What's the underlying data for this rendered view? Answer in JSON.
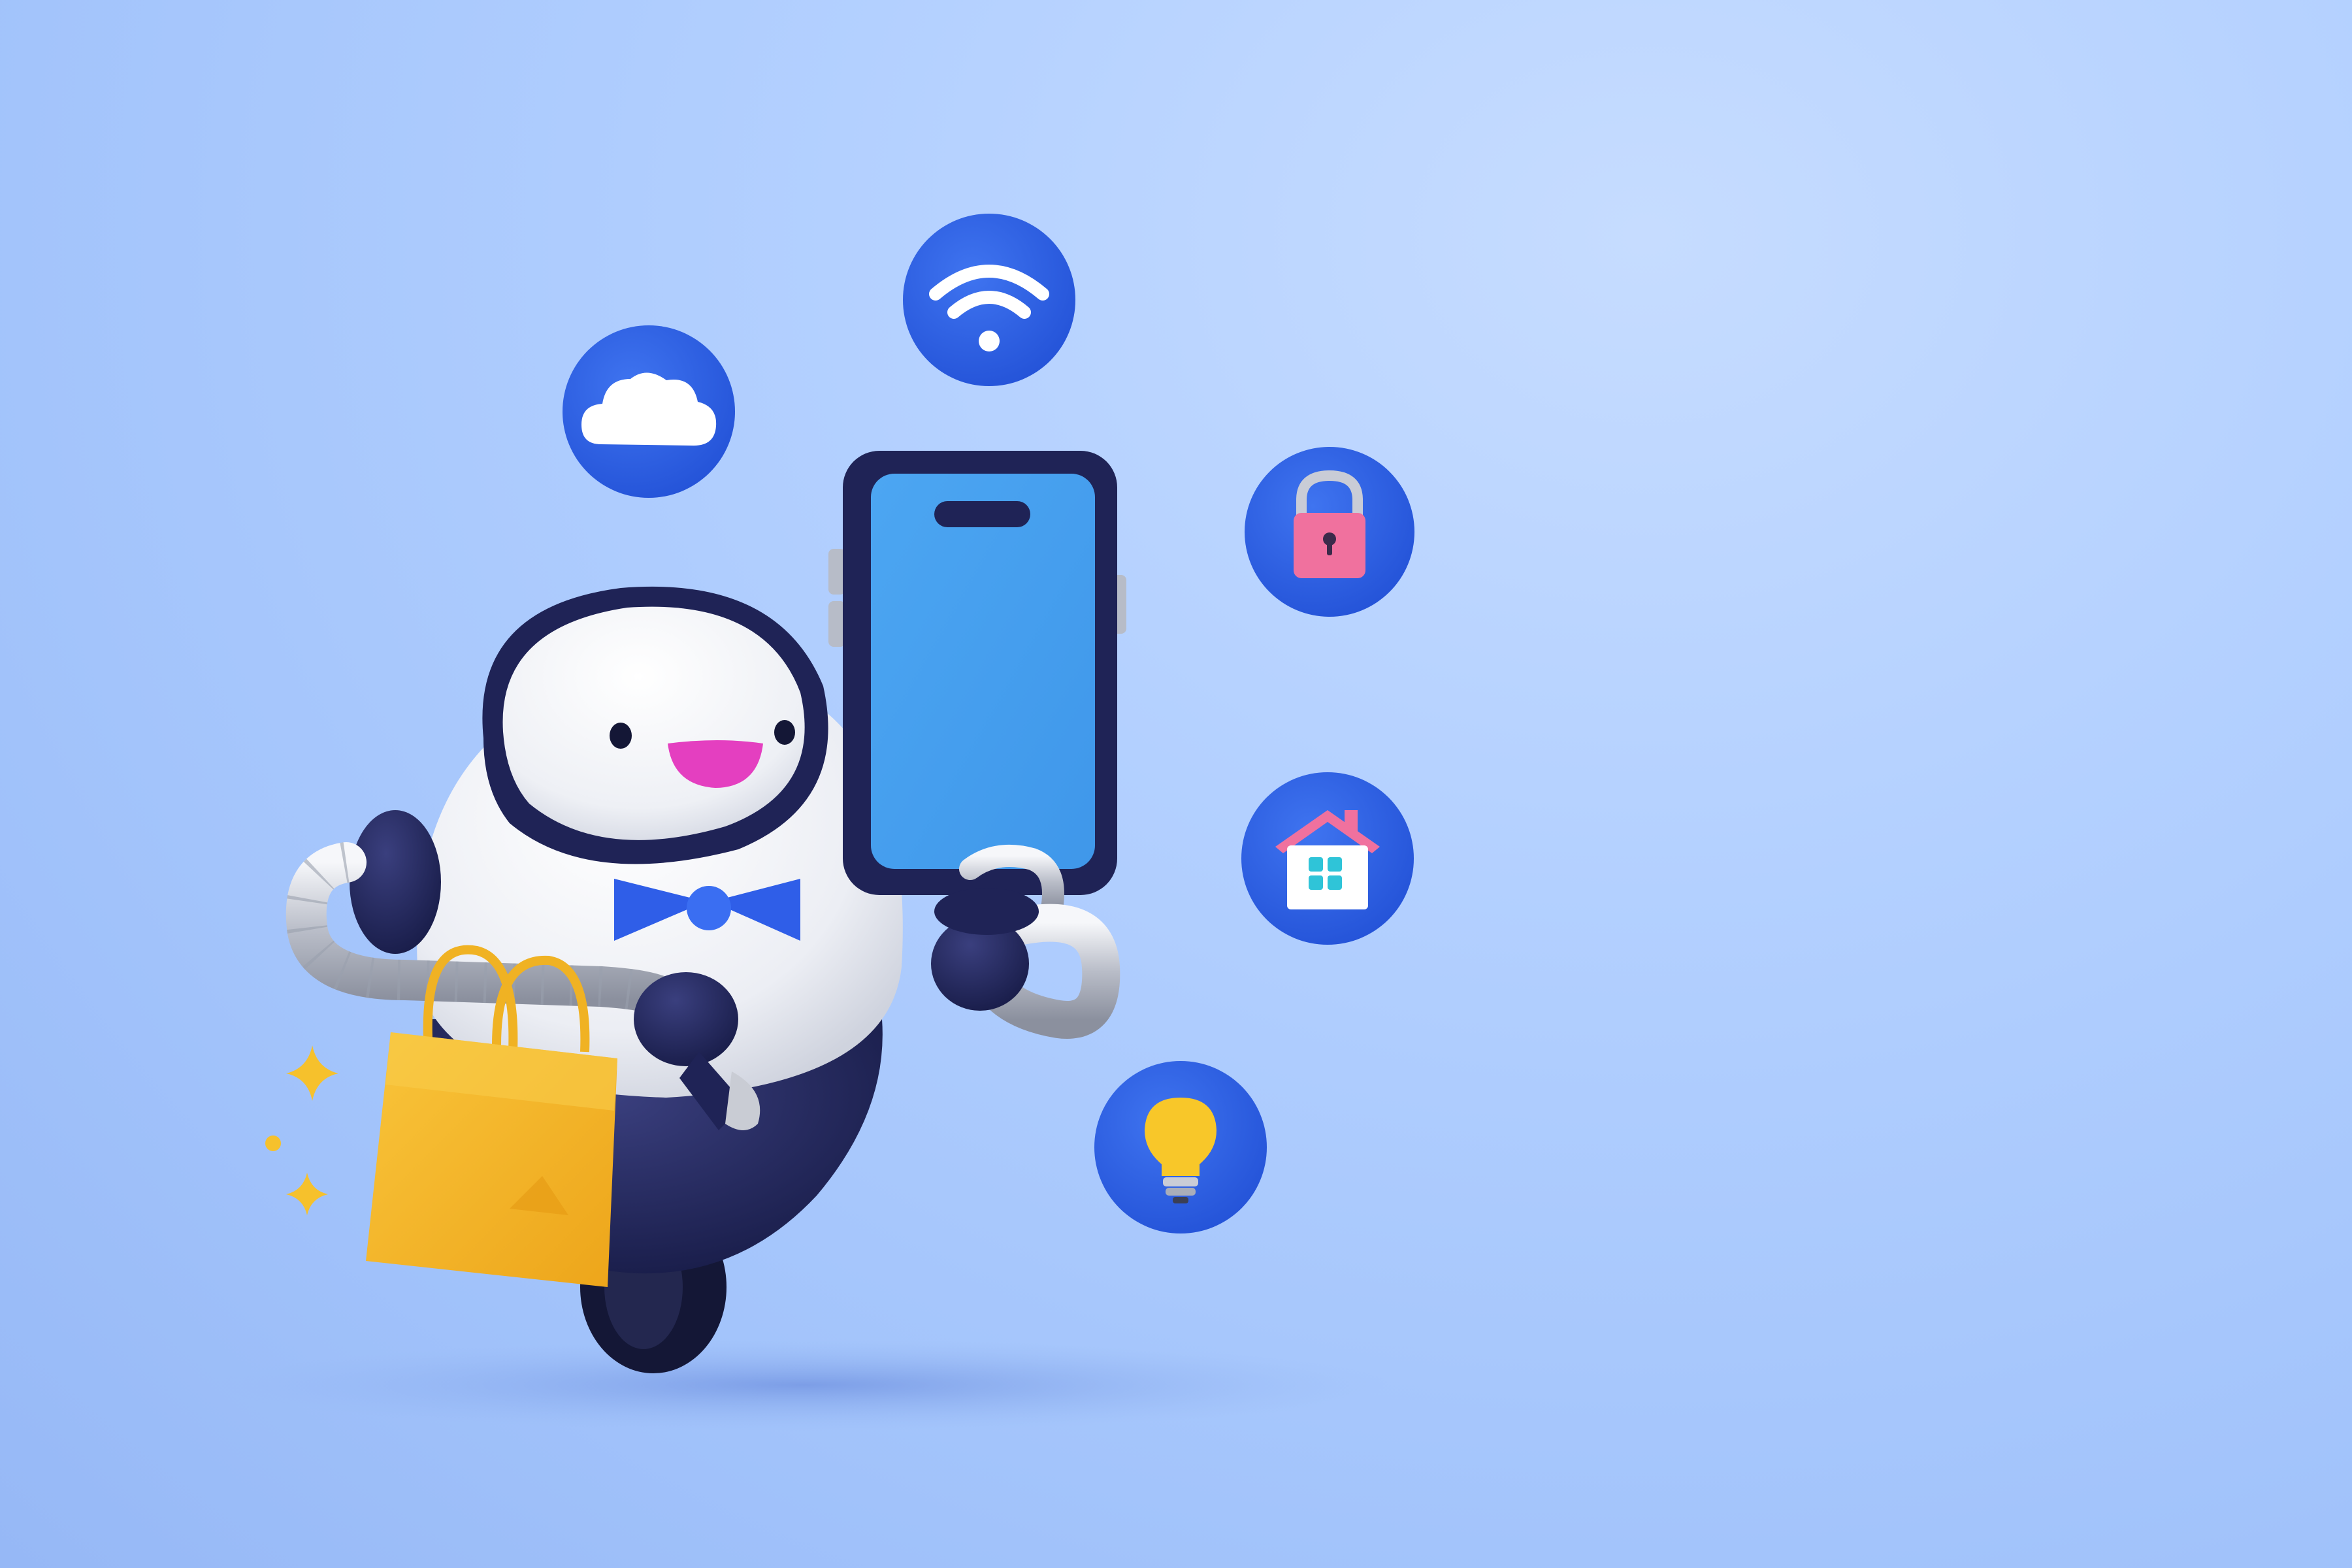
{
  "scene": {
    "subject": "robot-mascot",
    "robot": {
      "body_color": "#f3f4f8",
      "trim_color": "#1f2356",
      "mouth_color": "#e43fc0",
      "bowtie_color": "#2f5ee8",
      "arm_color": "#c9ccd4"
    },
    "phone": {
      "frame_color": "#1f2356",
      "screen_color": "#45a0ef"
    },
    "bag": {
      "color": "#f4b824"
    },
    "icon_bubble_color": "#2c5fe6",
    "icons": [
      {
        "name": "cloud-icon",
        "color": "#ffffff"
      },
      {
        "name": "wifi-icon",
        "color": "#ffffff"
      },
      {
        "name": "lock-icon",
        "color": "#f0719e"
      },
      {
        "name": "home-icon",
        "color": "#ffffff"
      },
      {
        "name": "lightbulb-icon",
        "color": "#f8c729"
      }
    ],
    "sparkle_color": "#f6c12c"
  }
}
